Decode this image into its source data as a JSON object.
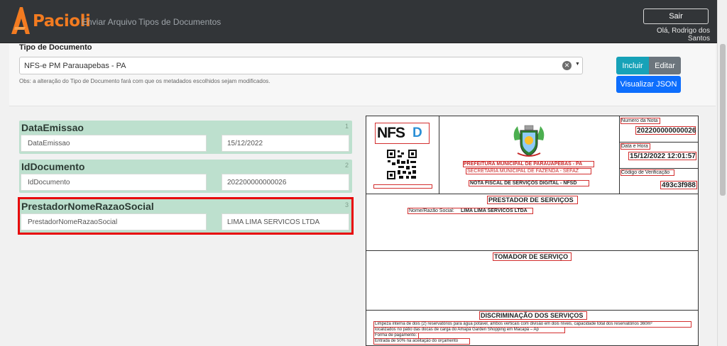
{
  "navbar": {
    "brand": "Pacioli",
    "links": [
      "Enviar Arquivo",
      "Tipos de Documentos"
    ],
    "logout_label": "Sair",
    "user_greeting": "Olá, Rodrigo dos Santos"
  },
  "form": {
    "tipo_label": "Tipo de Documento",
    "selected_document_type": "NFS-e PM Parauapebas - PA",
    "obs": "Obs: a alteração do Tipo de Documento fará com que os metadados escolhidos sejam modificados.",
    "buttons": {
      "incluir": "Incluir",
      "editar": "Editar",
      "visualizar_json": "Visualizar JSON"
    }
  },
  "metadata": [
    {
      "index": "1",
      "title": "DataEmissao",
      "field_name": "DataEmissao",
      "field_value": "15/12/2022"
    },
    {
      "index": "2",
      "title": "IdDocumento",
      "field_name": "IdDocumento",
      "field_value": "202200000000026"
    },
    {
      "index": "3",
      "title": "PrestadorNomeRazaoSocial",
      "field_name": "PrestadorNomeRazaoSocial",
      "field_value": "LIMA LIMA SERVICOS LTDA"
    }
  ],
  "preview": {
    "logo_text": "NFS",
    "logo_glyph": "D",
    "header_lines": [
      "PREFEITURA MUNICIPAL DE PARAUAPEBAS - PA",
      "SECRETARIA MUNICIPAL DE FAZENDA - SEFAZ",
      "NOTA FISCAL DE SERVIÇOS DIGITAL - NFSD"
    ],
    "numero_label": "Numero da Nota",
    "numero_value": "202200000000026",
    "data_label": "Data e Hora",
    "data_value": "15/12/2022 12:01:57",
    "codigo_label": "Código de Verificação",
    "codigo_value": "493c3f988",
    "prestador_title": "PRESTADOR DE SERVIÇOS",
    "prestador_line_label": "Nome/Razão Social:",
    "prestador_line_value": "LIMA LIMA SERVICOS LTDA",
    "tomador_title": "TOMADOR DE SERVIÇO",
    "discriminacao_title": "DISCRIMINAÇÃO DOS SERVIÇOS",
    "discriminacao_lines": [
      "Limpeza interna de dois (2) reservatórios para água potável, ambos verticais com divisão em dois níveis, capacidade total dos reservatórios 360m³",
      "localizados no pátio das docas de carga do Amapá Garden Shopping em Macapá – Ap",
      "Forma de pagamento:",
      "Entrada de 50% na aceitação do orçamento"
    ]
  },
  "colors": {
    "navbar_bg": "#323538",
    "brand_orange": "#f37b20",
    "card_green": "#bde0ce",
    "highlight_red": "#e8060a",
    "btn_info": "#17a2b8",
    "btn_secondary": "#6c757d",
    "btn_primary": "#0d6efd"
  }
}
